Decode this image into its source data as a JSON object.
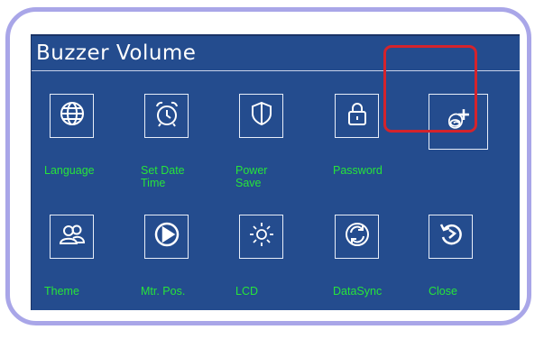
{
  "screen": {
    "title": "Buzzer Volume"
  },
  "menu": {
    "row1": [
      {
        "label": "Language",
        "icon": "globe-icon"
      },
      {
        "label": "Set Date\nTime",
        "icon": "alarm-clock-icon"
      },
      {
        "label": "Power\nSave",
        "icon": "shield-icon"
      },
      {
        "label": "Password",
        "icon": "lock-icon"
      },
      {
        "label": "",
        "icon": "buzzer-volume-plus-icon"
      }
    ],
    "row2": [
      {
        "label": "Theme",
        "icon": "users-icon"
      },
      {
        "label": "Mtr. Pos.",
        "icon": "play-circle-icon"
      },
      {
        "label": "LCD",
        "icon": "sun-icon"
      },
      {
        "label": "DataSync",
        "icon": "sync-icon"
      },
      {
        "label": "Close",
        "icon": "undo-icon"
      }
    ]
  },
  "colors": {
    "screen_bg": "#244c8e",
    "label_text": "#27e43a",
    "highlight": "#d4232c",
    "frame": "#a9a6e8"
  }
}
